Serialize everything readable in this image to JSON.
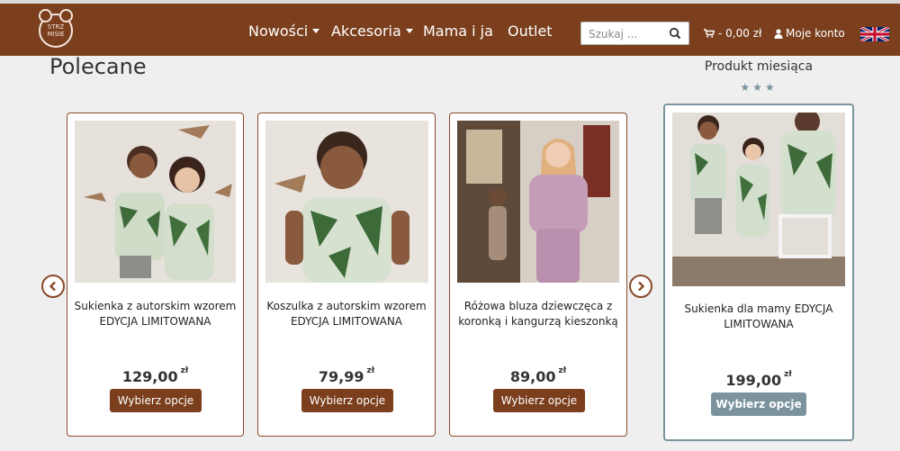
{
  "header": {
    "logo_text_line1": "STRZ",
    "logo_text_line2": "MISIE",
    "nav": [
      {
        "label": "Nowości",
        "dropdown": true
      },
      {
        "label": "Akcesoria",
        "dropdown": true
      },
      {
        "label": "Mama i ja",
        "dropdown": false
      },
      {
        "label": "Outlet",
        "dropdown": false
      }
    ],
    "search_placeholder": "Szukaj ...",
    "cart_label": "0,00 zł",
    "account_label": "Moje konto",
    "language_flag": "uk-flag-icon"
  },
  "recommended": {
    "title": "Polecane",
    "products": [
      {
        "name_line1": "Sukienka z autorskim wzorem",
        "name_line2": "EDYCJA LIMITOWANA",
        "price": "129,00",
        "currency": "zł",
        "button": "Wybierz opcje"
      },
      {
        "name_line1": "Koszulka z autorskim wzorem",
        "name_line2": "EDYCJA LIMITOWANA",
        "price": "79,99",
        "currency": "zł",
        "button": "Wybierz opcje"
      },
      {
        "name_line1": "Różowa bluza dziewczęca z",
        "name_line2": "koronką i kangurzą kieszonką",
        "price": "89,00",
        "currency": "zł",
        "button": "Wybierz opcje"
      }
    ]
  },
  "product_of_month": {
    "title": "Produkt miesiąca",
    "stars": "★★★",
    "name_line1": "Sukienka dla mamy EDYCJA",
    "name_line2": "LIMITOWANA",
    "price": "199,00",
    "currency": "zł",
    "button": "Wybierz opcje"
  },
  "colors": {
    "brand_brown": "#7b3f1d",
    "featured_accent": "#7b939d"
  }
}
